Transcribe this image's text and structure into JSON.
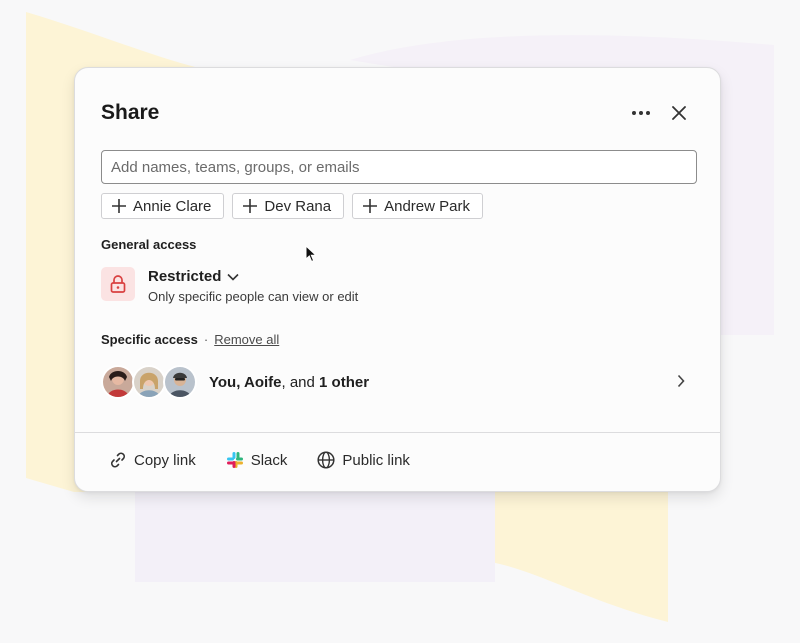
{
  "dialog": {
    "title": "Share",
    "more_icon": "more-horizontal-icon",
    "close_icon": "close-icon"
  },
  "search": {
    "placeholder": "Add names, teams, groups, or emails",
    "value": ""
  },
  "suggestions": [
    {
      "label": "Annie Clare",
      "icon": "plus-icon"
    },
    {
      "label": "Dev Rana",
      "icon": "plus-icon"
    },
    {
      "label": "Andrew Park",
      "icon": "plus-icon"
    }
  ],
  "general_access": {
    "label": "General access",
    "icon": "lock-icon",
    "selected": "Restricted",
    "description": "Only specific people can view or edit"
  },
  "specific_access": {
    "label": "Specific access",
    "separator": "·",
    "remove_all": "Remove all",
    "people_prefix": "You, Aoife",
    "people_mid": ", and ",
    "people_suffix": "1 other"
  },
  "footer": {
    "copy_link": "Copy link",
    "slack": "Slack",
    "public_link": "Public link"
  },
  "colors": {
    "lock_bg": "#fbe3e3",
    "lock_red": "#d94040",
    "background_yellow": "#fdf4d6",
    "background_lilac": "#f3f0f8"
  }
}
